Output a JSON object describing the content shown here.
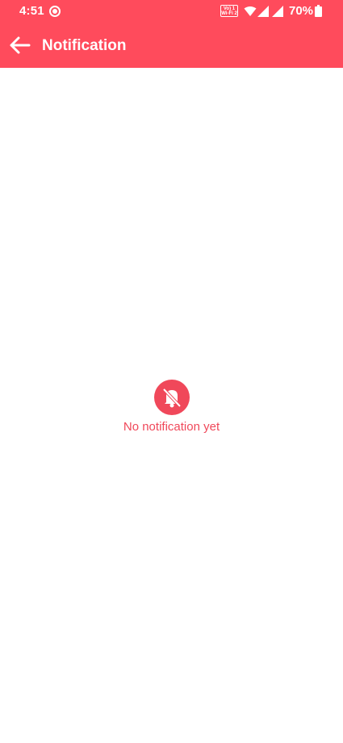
{
  "status_bar": {
    "time": "4:51",
    "volte_line1": "Vo) 1",
    "volte_line2": "Wi-Fi 2",
    "battery": "70%",
    "icons": [
      "record-icon",
      "volte-icon",
      "wifi-icon",
      "signal-icon",
      "signal-icon",
      "battery-icon"
    ]
  },
  "app_bar": {
    "title": "Notification",
    "back_icon": "arrow-left-icon"
  },
  "empty_state": {
    "icon": "bell-off-icon",
    "message": "No notification yet"
  },
  "colors": {
    "primary": "#ff4b5c",
    "empty_text": "#f0485a",
    "background": "#ffffff"
  }
}
